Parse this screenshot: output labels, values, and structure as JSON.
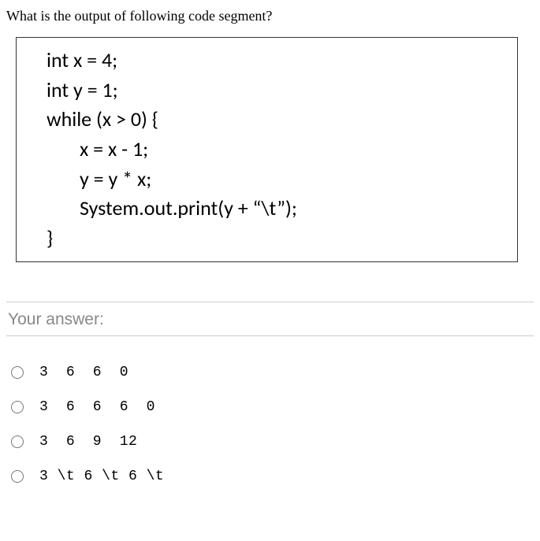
{
  "question": "What is the output of following code segment?",
  "code": {
    "l1": "int x = 4;",
    "l2": "int y = 1;",
    "l3": "while (x > 0) {",
    "l4": "x = x - 1;",
    "l5": "y = y * x;",
    "l6": "System.out.print(y + “\\t”);",
    "l7": "}"
  },
  "answer_label": "Your answer:",
  "options": {
    "a": "3  6  6  0",
    "b": "3  6  6  6  0",
    "c": "3  6  9  12",
    "d": "3 \\t 6 \\t 6 \\t"
  }
}
